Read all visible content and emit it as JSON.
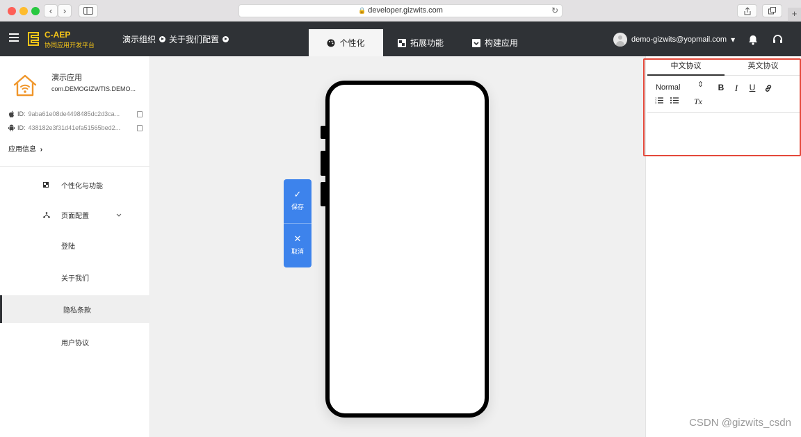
{
  "browser": {
    "url": "developer.gizwits.com",
    "back": "‹",
    "forward": "›",
    "new_tab": "+"
  },
  "header": {
    "brand_title": "C-AEP",
    "brand_subtitle": "协同应用开发平台",
    "breadcrumbs": [
      "演示组织",
      "关于我们配置"
    ],
    "tabs": [
      {
        "label": "个性化",
        "active": true
      },
      {
        "label": "拓展功能",
        "active": false
      },
      {
        "label": "构建应用",
        "active": false
      }
    ],
    "user_email": "demo-gizwits@yopmail.com",
    "user_caret": "▾"
  },
  "sidebar": {
    "app_name": "演示应用",
    "app_package": "com.DEMOGIZWTIS.DEMO...",
    "ios_id_label": "ID:",
    "ios_id": "9aba61e08de4498485dc2d3ca...",
    "android_id_label": "ID:",
    "android_id": "438182e3f31d41efa51565bed2...",
    "app_info": "应用信息",
    "app_info_arrow": "›",
    "menu": [
      {
        "label": "个性化与功能",
        "selected": false
      },
      {
        "label": "页面配置",
        "selected": false,
        "expandable": true
      },
      {
        "label": "登陆",
        "selected": false
      },
      {
        "label": "关于我们",
        "selected": false
      },
      {
        "label": "隐私条款",
        "selected": true
      },
      {
        "label": "用户协议",
        "selected": false
      }
    ]
  },
  "actions": {
    "save_symbol": "✓",
    "save": "保存",
    "cancel_symbol": "✕",
    "cancel": "取消"
  },
  "editor": {
    "tabs": [
      "中文协议",
      "英文协议"
    ],
    "active_tab": 0,
    "format_select": "Normal",
    "format_arrows": "⇕",
    "bold": "B",
    "italic": "I",
    "underline": "U",
    "clear_format": "Tx",
    "content": ""
  },
  "watermark": "CSDN @gizwits_csdn",
  "colors": {
    "header_bg": "#2f3236",
    "brand": "#f5c518",
    "accent": "#3d83ec",
    "highlight": "#e4483a"
  }
}
